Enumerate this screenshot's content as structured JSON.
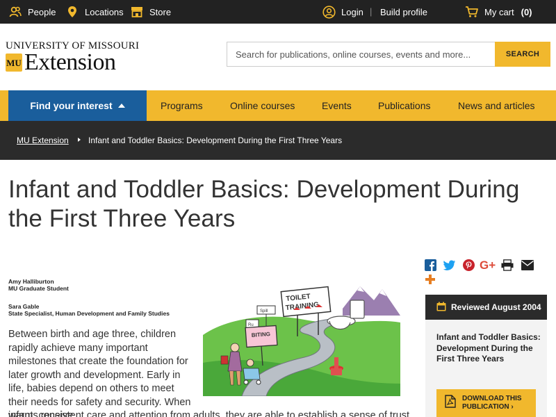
{
  "topbar": {
    "people": "People",
    "locations": "Locations",
    "store": "Store",
    "login": "Login",
    "separator": "|",
    "build_profile": "Build profile",
    "cart": "My cart",
    "cart_count": "(0)"
  },
  "header": {
    "logo_top": "UNIVERSITY OF MISSOURI",
    "logo_mu": "MU",
    "logo_main": "Extension",
    "search_placeholder": "Search for publications, online courses, events and more...",
    "search_button": "SEARCH"
  },
  "nav": {
    "find": "Find your interest",
    "items": [
      "Programs",
      "Online courses",
      "Events",
      "Publications",
      "News and articles"
    ]
  },
  "breadcrumb": {
    "home": "MU Extension",
    "current": "Infant and Toddler Basics: Development During the First Three Years"
  },
  "page": {
    "title": "Infant and Toddler Basics: Development During the First Three Years",
    "authors": [
      {
        "name": "Amy Halliburton",
        "role": "MU Graduate Student"
      },
      {
        "name": "Sara Gable",
        "role": "State Specialist, Human Development and Family Studies"
      }
    ],
    "body_wrapped": "Between birth and age three, children rapidly achieve many important milestones that create the foundation for later growth and development. Early in life, babies depend on others to meet their needs for safety and security. When infants receive",
    "body_continued": "warm, consistent care and attention from adults, they are able to establish a sense of trust"
  },
  "illustration": {
    "sign_toilet": "TOILET",
    "sign_training": "TRAINING",
    "sign_biting": "BITING",
    "sign_small_1": "Spill",
    "sign_small_2": "Ru"
  },
  "sidebar": {
    "reviewed": "Reviewed August 2004",
    "pub_title": "Infant and Toddler Basics: Development During the First Three Years",
    "download_line1": "DOWNLOAD THIS",
    "download_line2": "PUBLICATION ›"
  },
  "colors": {
    "gold": "#f1b82d",
    "dark": "#222222",
    "blue": "#1a5e9c"
  }
}
